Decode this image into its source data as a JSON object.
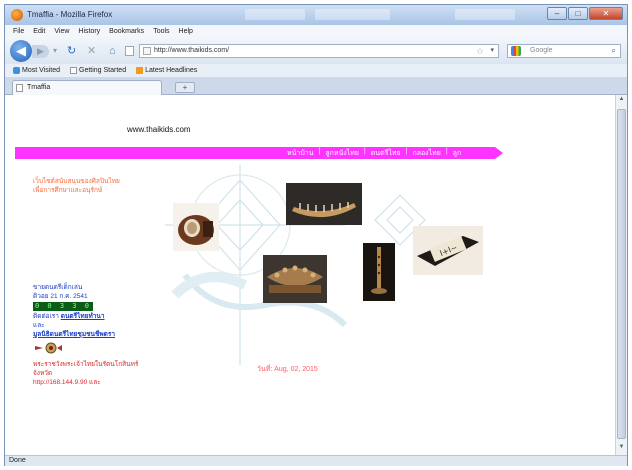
{
  "window": {
    "title": "Tmaffia - Mozilla Firefox",
    "background_taskbar": [
      "",
      ""
    ]
  },
  "menubar": [
    "File",
    "Edit",
    "View",
    "History",
    "Bookmarks",
    "Tools",
    "Help"
  ],
  "navbar": {
    "url": "http://www.thaikids.com/",
    "search_placeholder": "Google"
  },
  "bookmarks": [
    "Most Visited",
    "Getting Started",
    "Latest Headlines"
  ],
  "tab": {
    "label": "Tmaffia"
  },
  "page": {
    "site_url": "www.thaikids.com",
    "nav": [
      "หน้าบ้าน",
      "|",
      "ลูกหนังไทย",
      "|",
      "ดนตรีไทย",
      "|",
      "กลองไทย",
      "|",
      "ลูก"
    ],
    "orange_text": [
      "เว็บไซต์สนับสนุนของศิลปินไทย",
      "เพื่อการศึกษาและอนุรักษ์"
    ],
    "left": {
      "line1": "ขายดนตรีเด็กเล่น",
      "line2": "ดิวอย 21 ก.ค. 2541",
      "counter": "0 0 3 3 0",
      "line3_prefix": "ติดต่อเรา",
      "line3_link": "ดนตรีไทยทำนา",
      "line4": "และ",
      "line5": "มูลนิธิดนตรีไทยชุมชนชีพตรา",
      "red1": "พระราชวังพระเจ้าไทยในรัตนโกสินทร์",
      "red2": "จังหวัด",
      "red3": "http://168.144.9.90 และ"
    },
    "date": "วันที่: Aug, 02, 2015"
  },
  "status": "Done",
  "colors": {
    "pink": "#ff33ff",
    "orange": "#ff6a3d",
    "blue": "#1a3ec8",
    "red": "#e0242b"
  }
}
